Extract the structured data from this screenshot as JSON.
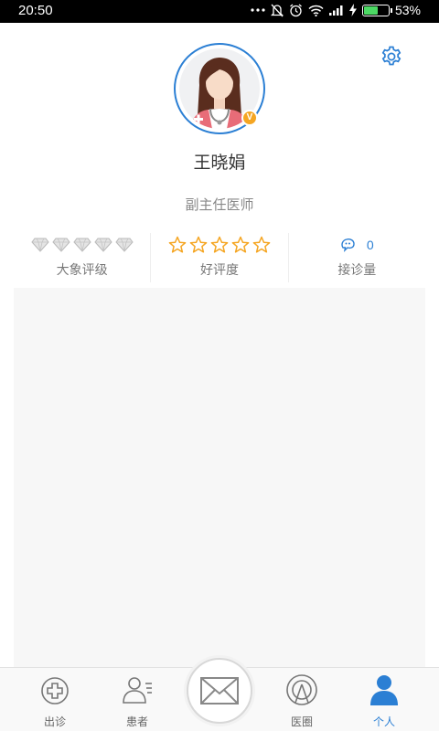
{
  "status_bar": {
    "time": "20:50",
    "icons": [
      "dots-icon",
      "mute-icon",
      "alarm-icon",
      "wifi-icon",
      "signal-icon",
      "charging-icon",
      "battery-icon"
    ],
    "battery_percent": "53%",
    "battery_level": 0.53
  },
  "profile": {
    "name": "王晓娟",
    "title": "副主任医师",
    "verified_badge": "V",
    "accent_color": "#2b7fd4",
    "badge_color": "#f5a623"
  },
  "stats": [
    {
      "label": "大象评级",
      "icon": "diamond-icon",
      "count": 5,
      "filled": 0
    },
    {
      "label": "好评度",
      "icon": "star-icon",
      "count": 5,
      "filled": 0,
      "color": "#f5a623"
    },
    {
      "label": "接诊量",
      "icon": "consult-icon",
      "value": "0"
    }
  ],
  "tabbar": {
    "tabs": [
      {
        "label": "出诊",
        "icon": "medical-cross-icon"
      },
      {
        "label": "患者",
        "icon": "patients-icon"
      },
      {
        "label": "",
        "icon": "mail-icon"
      },
      {
        "label": "医圈",
        "icon": "doctor-circle-icon"
      },
      {
        "label": "个人",
        "icon": "person-icon",
        "active": true
      }
    ]
  }
}
